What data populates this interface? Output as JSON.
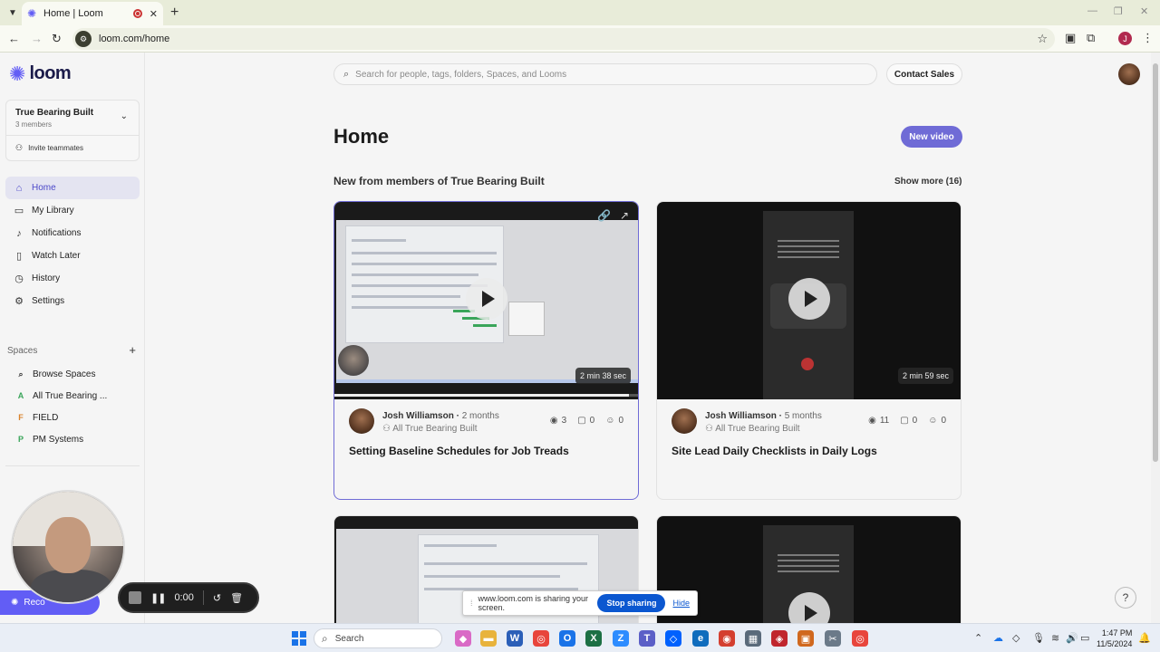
{
  "browser": {
    "tab_title": "Home | Loom",
    "url": "loom.com/home",
    "profile_initial": "J",
    "tab_list_icon": "chevron-down-icon",
    "new_tab_icon": "plus-icon"
  },
  "brand": {
    "name": "loom",
    "accent": "#625df5"
  },
  "workspace": {
    "name": "True Bearing Built",
    "members": "3 members",
    "invite_label": "Invite teammates"
  },
  "sidebar": {
    "items": [
      {
        "label": "Home",
        "icon": "home-icon",
        "active": true
      },
      {
        "label": "My Library",
        "icon": "library-icon"
      },
      {
        "label": "Notifications",
        "icon": "bell-icon"
      },
      {
        "label": "Watch Later",
        "icon": "bookmark-icon"
      },
      {
        "label": "History",
        "icon": "history-icon"
      },
      {
        "label": "Settings",
        "icon": "gear-icon"
      }
    ],
    "spaces_heading": "Spaces",
    "spaces": [
      {
        "badge": "",
        "label": "Browse Spaces",
        "icon": "search-icon"
      },
      {
        "badge": "A",
        "label": "All True Bearing ...",
        "color": "#3aa55a"
      },
      {
        "badge": "F",
        "label": "FIELD",
        "color": "#d9822b"
      },
      {
        "badge": "P",
        "label": "PM Systems",
        "color": "#3aa55a"
      }
    ]
  },
  "header": {
    "search_placeholder": "Search for people, tags, folders, Spaces, and Looms",
    "contact_sales": "Contact Sales"
  },
  "main": {
    "title": "Home",
    "new_video": "New video",
    "section_title": "New from members of True Bearing Built",
    "show_more": "Show more (16)",
    "videos": [
      {
        "author": "Josh Williamson",
        "age": "2 months",
        "space": "All True Bearing Built",
        "views": "3",
        "comments": "0",
        "reactions": "0",
        "title": "Setting Baseline Schedules for Job Treads",
        "duration": "2 min 38 sec",
        "progress": 0.97
      },
      {
        "author": "Josh Williamson",
        "age": "5 months",
        "space": "All True Bearing Built",
        "views": "11",
        "comments": "0",
        "reactions": "0",
        "title": "Site Lead Daily Checklists in Daily Logs",
        "duration": "2 min 59 sec"
      }
    ]
  },
  "recording": {
    "rec_label": "Reco",
    "timer": "0:00"
  },
  "screen_share": {
    "message": "www.loom.com is sharing your screen.",
    "stop": "Stop sharing",
    "hide": "Hide"
  },
  "taskbar": {
    "search_label": "Search",
    "time": "1:47 PM",
    "date": "11/5/2024"
  }
}
